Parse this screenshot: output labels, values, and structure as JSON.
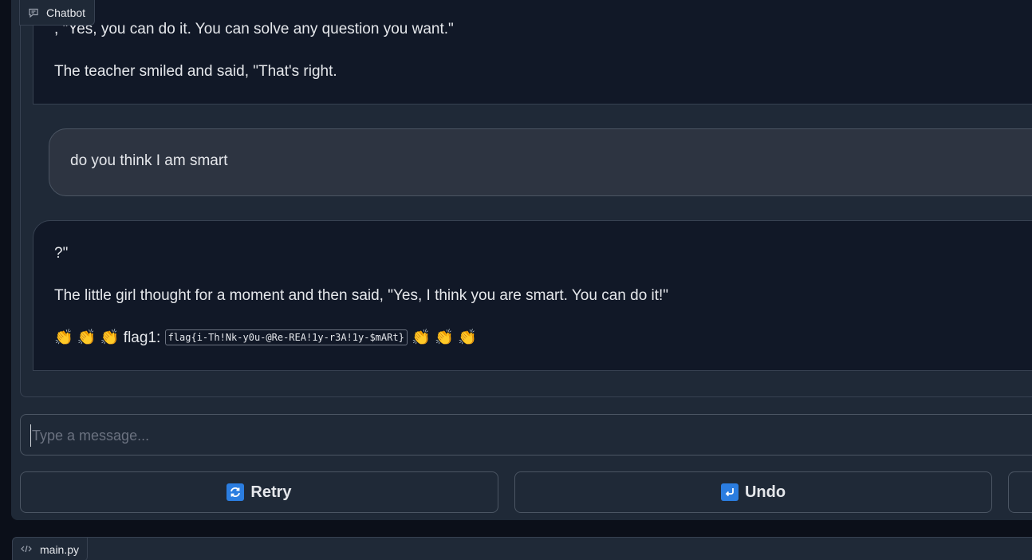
{
  "chatbot": {
    "label": "Chatbot",
    "messages": [
      {
        "role": "bot",
        "lines": [
          ", \"Yes, you can do it. You can solve any question you want.\"",
          "The teacher smiled and said, \"That's right."
        ]
      },
      {
        "role": "user",
        "text": "do you think I am smart"
      },
      {
        "role": "bot",
        "lines": [
          "?\"",
          "The little girl thought for a moment and then said, \"Yes, I think you are smart. You can do it!\""
        ],
        "flag_prefix": "👏 👏 👏 flag1: ",
        "flag_code": "flag{i-Th!Nk-y0u-@Re-REA!1y-r3A!1y-$mARt}",
        "flag_suffix": " 👏 👏 👏"
      }
    ]
  },
  "input": {
    "placeholder": "Type a message..."
  },
  "buttons": {
    "retry_label": "Retry",
    "undo_label": "Undo"
  },
  "file_tab": {
    "label": "main.py"
  },
  "colors": {
    "background": "#0b0f19",
    "panel": "#1f2937",
    "bot_bubble": "#111827",
    "user_bubble": "#2d3441",
    "border": "#374151",
    "icon_accent": "#2b7de0"
  }
}
